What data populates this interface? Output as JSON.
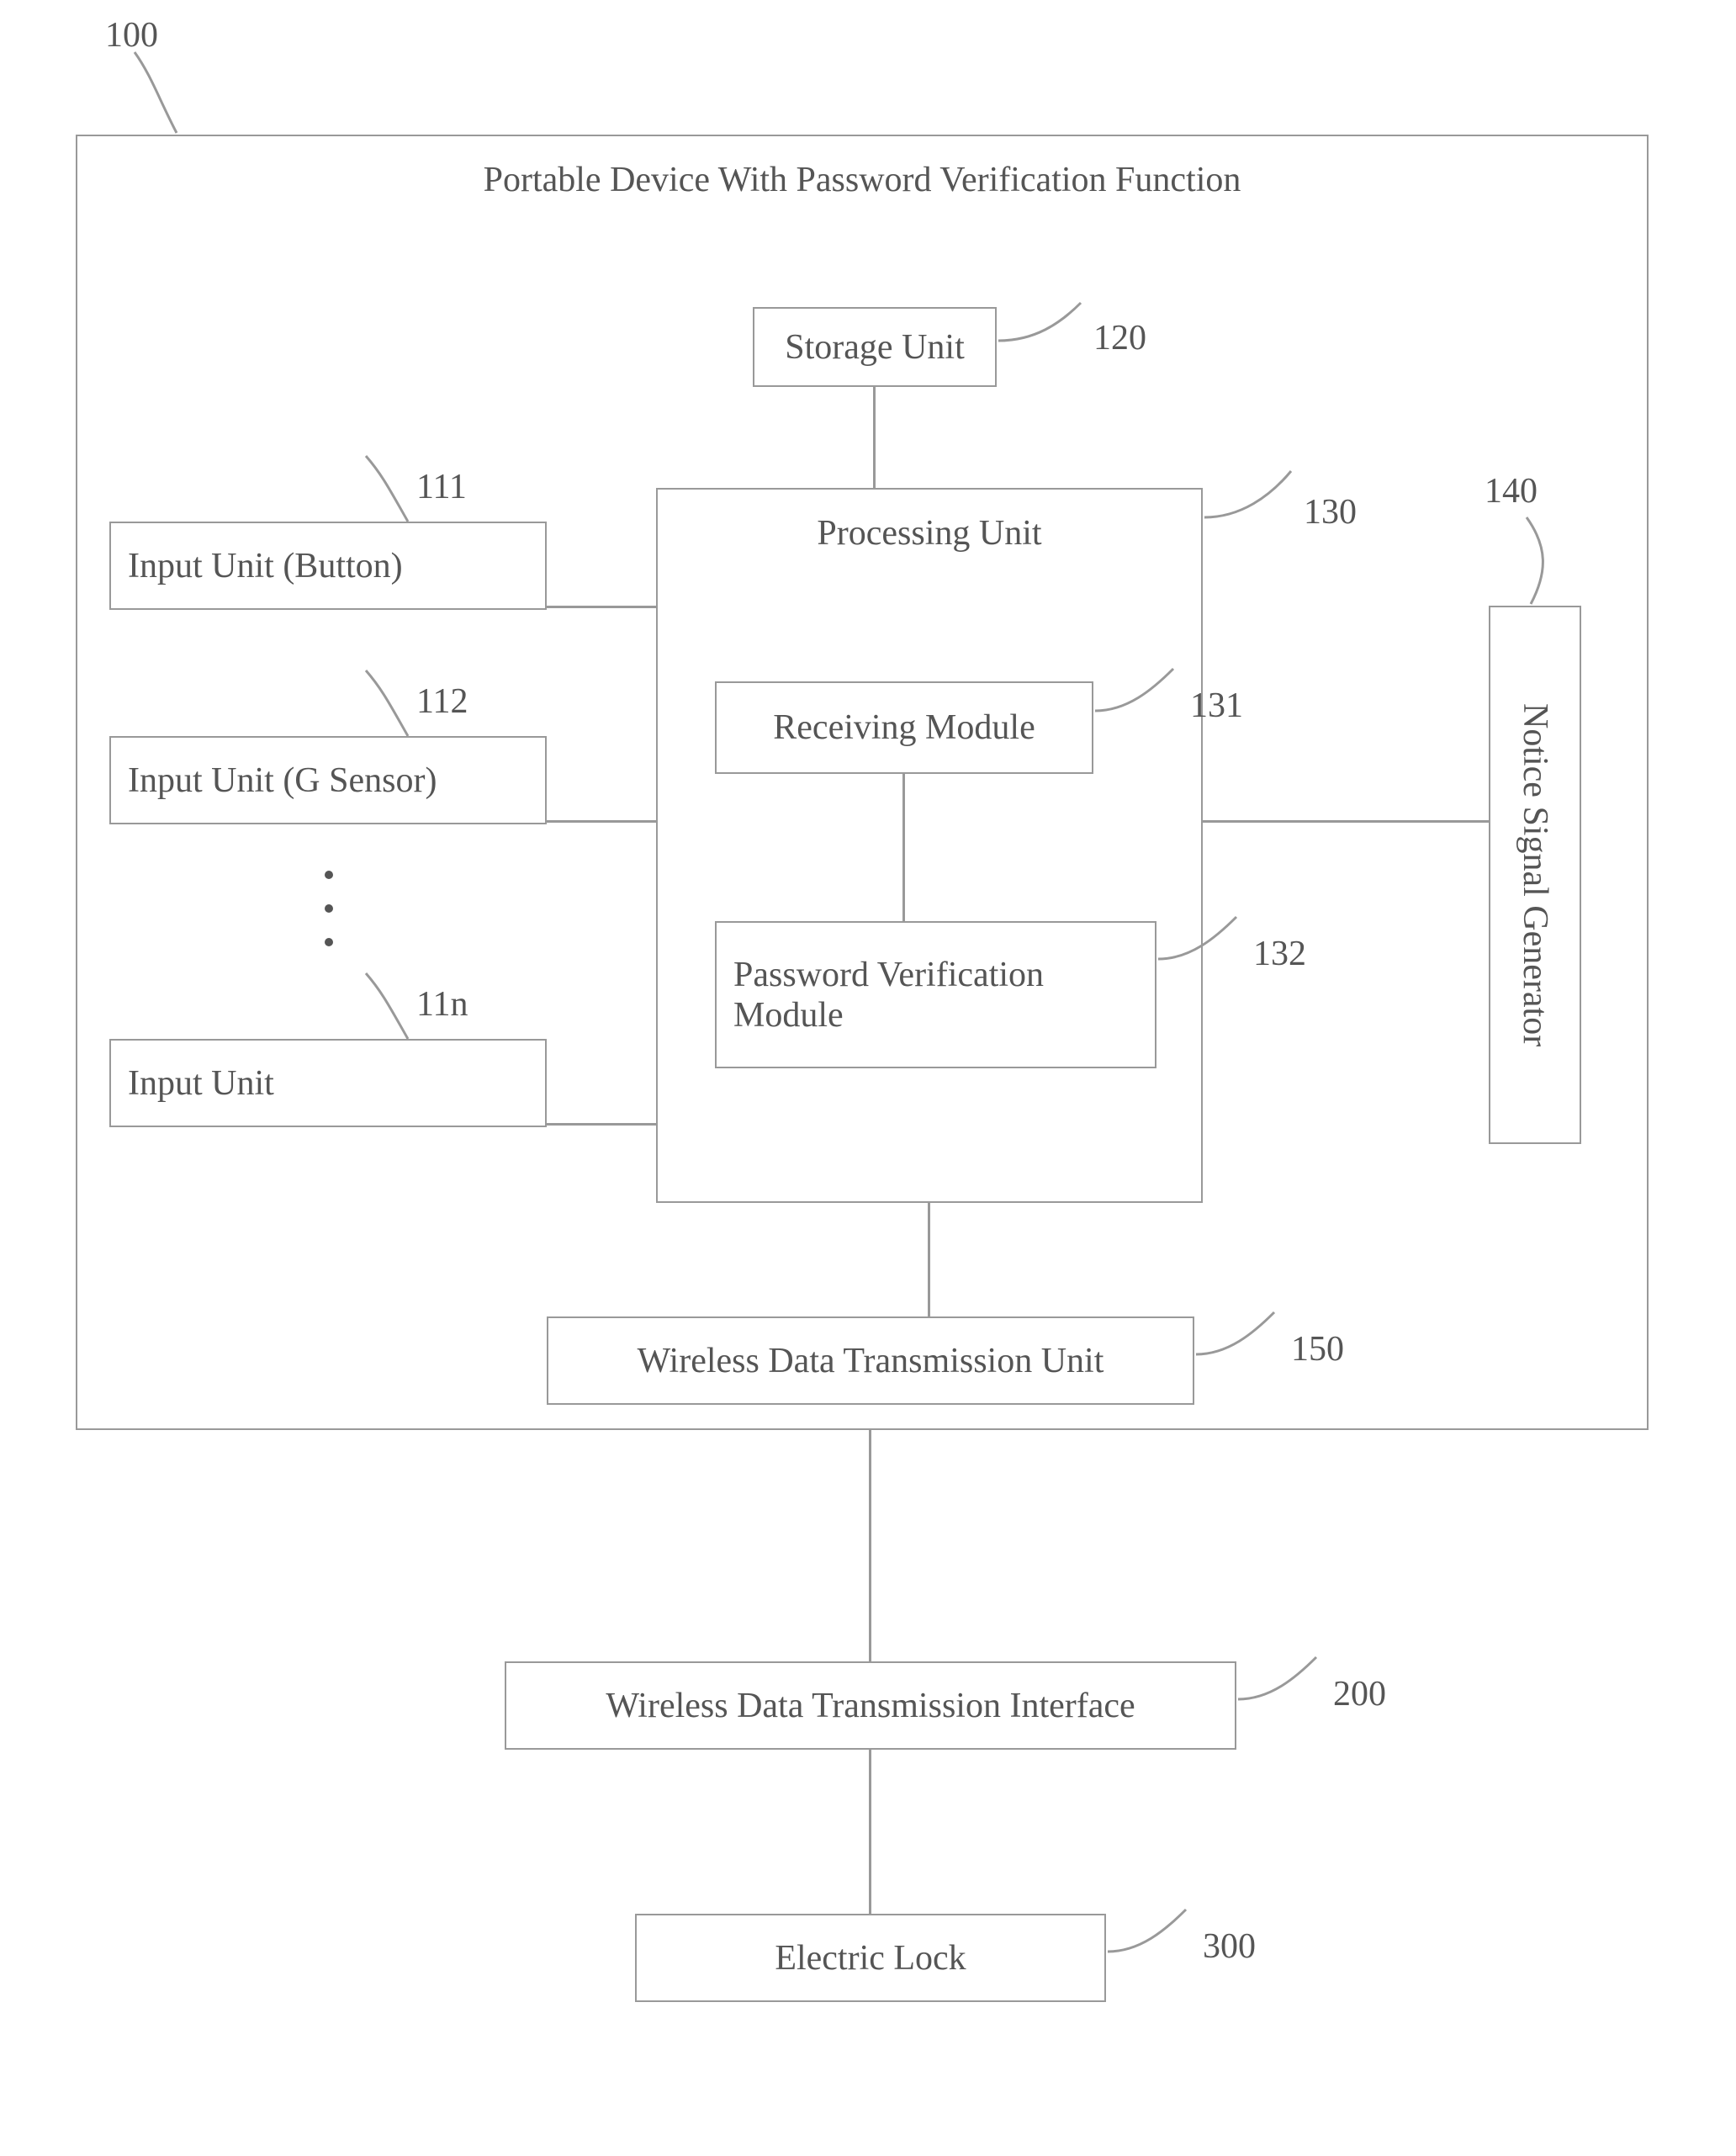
{
  "refs": {
    "device": "100",
    "input_button": "111",
    "input_gsensor": "112",
    "input_n": "11n",
    "storage": "120",
    "processing": "130",
    "receiving": "131",
    "password_verify": "132",
    "notice_gen": "140",
    "wireless_unit": "150",
    "wireless_if": "200",
    "electric_lock": "300"
  },
  "blocks": {
    "device_title": "Portable Device With Password Verification Function",
    "input_button": "Input Unit (Button)",
    "input_gsensor": "Input Unit (G Sensor)",
    "input_n": "Input Unit",
    "storage": "Storage Unit",
    "processing": "Processing Unit",
    "receiving": "Receiving Module",
    "password_verify": "Password Verification Module",
    "notice_gen": "Notice Signal Generator",
    "wireless_unit": "Wireless Data Transmission Unit",
    "wireless_if": "Wireless Data Transmission Interface",
    "electric_lock": "Electric Lock"
  }
}
